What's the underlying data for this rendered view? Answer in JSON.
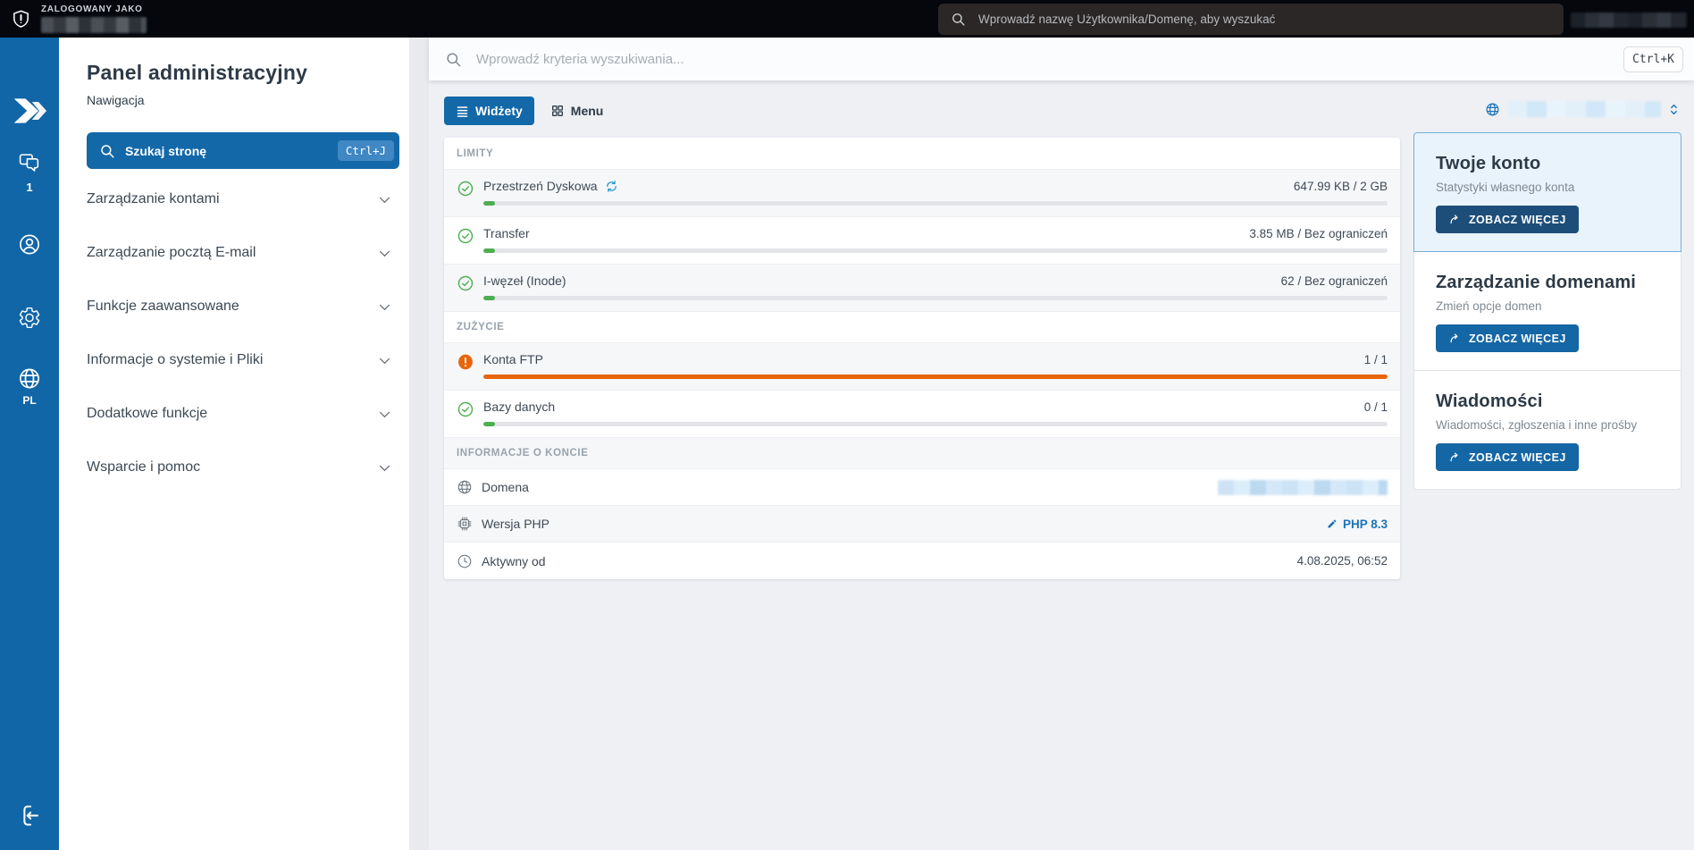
{
  "topbar": {
    "logged_in_as": "ZALOGOWANY JAKO",
    "search_placeholder": "Wprowadź nazwę Użytkownika/Domenę, aby wyszukać"
  },
  "iconbar": {
    "notifications_count": "1",
    "language": "PL"
  },
  "nav": {
    "title": "Panel administracyjny",
    "subtitle": "Nawigacja",
    "search_label": "Szukaj stronę",
    "search_shortcut": "Ctrl+J",
    "items": [
      {
        "label": "Zarządzanie kontami"
      },
      {
        "label": "Zarządzanie pocztą E-mail"
      },
      {
        "label": "Funkcje zaawansowane"
      },
      {
        "label": "Informacje o systemie i Pliki"
      },
      {
        "label": "Dodatkowe funkcje"
      },
      {
        "label": "Wsparcie i pomoc"
      }
    ]
  },
  "main": {
    "search_placeholder": "Wprowadź kryteria wyszukiwania...",
    "search_shortcut": "Ctrl+K",
    "tabs": [
      {
        "label": "Widżety",
        "active": true
      },
      {
        "label": "Menu",
        "active": false
      }
    ],
    "sections": {
      "limits": {
        "header": "LIMITY",
        "rows": [
          {
            "label": "Przestrzeń Dyskowa",
            "value": "647.99 KB / 2 GB",
            "status": "ok"
          },
          {
            "label": "Transfer",
            "value": "3.85 MB / Bez ograniczeń",
            "status": "ok"
          },
          {
            "label": "I-węzeł (Inode)",
            "value": "62 / Bez ograniczeń",
            "status": "ok"
          }
        ]
      },
      "usage": {
        "header": "ZUŻYCIE",
        "rows": [
          {
            "label": "Konta FTP",
            "value": "1 / 1",
            "status": "warning"
          },
          {
            "label": "Bazy danych",
            "value": "0 / 1",
            "status": "ok"
          }
        ]
      },
      "account": {
        "header": "INFORMACJE O KONCIE",
        "rows": [
          {
            "label": "Domena",
            "value": ""
          },
          {
            "label": "Wersja PHP",
            "value": "PHP 8.3"
          },
          {
            "label": "Aktywny od",
            "value": "4.08.2025, 06:52"
          }
        ]
      }
    }
  },
  "panel": {
    "cards": [
      {
        "title": "Twoje konto",
        "subtitle": "Statystyki własnego konta",
        "button": "ZOBACZ WIĘCEJ"
      },
      {
        "title": "Zarządzanie domenami",
        "subtitle": "Zmień opcje domen",
        "button": "ZOBACZ WIĘCEJ"
      },
      {
        "title": "Wiadomości",
        "subtitle": "Wiadomości, zgłoszenia i inne prośby",
        "button": "ZOBACZ WIĘCEJ"
      }
    ]
  },
  "colors": {
    "topbar_bg": "#05070d",
    "sidebar_blue": "#1166a7",
    "accent_blue": "#1368a8",
    "button_dark": "#1d4e79",
    "success_green": "#4caf50",
    "warning_orange": "#e8650c",
    "link_blue": "#1b74b8",
    "main_bg": "#eef0f4"
  }
}
